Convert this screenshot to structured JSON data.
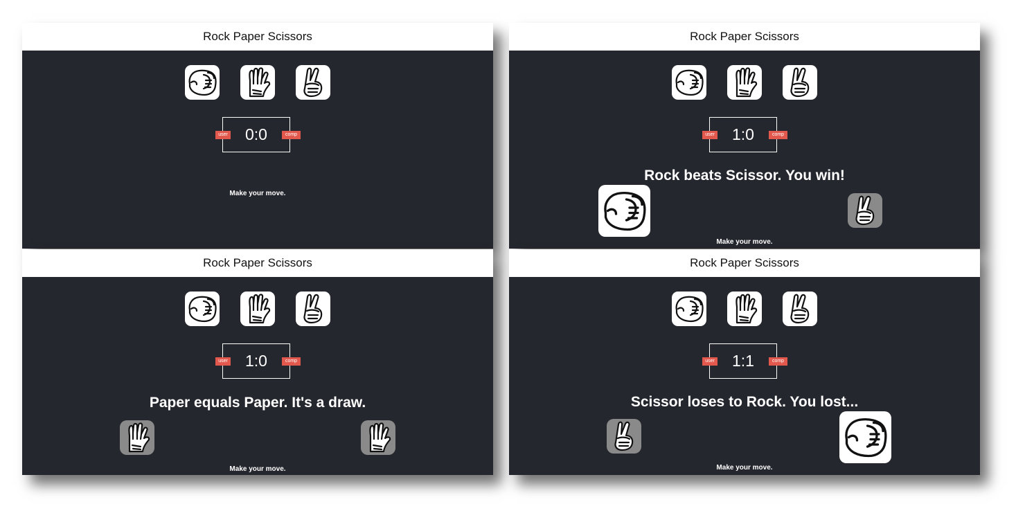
{
  "app_title": "Rock Paper Scissors",
  "labels": {
    "user": "user",
    "comp": "comp",
    "hint": "Make your move."
  },
  "choices": [
    "rock",
    "paper",
    "scissors"
  ],
  "colors": {
    "background": "#25272e",
    "badge": "#e2584d",
    "header": "#ffffff",
    "dim_hand": "#8a8a8a"
  },
  "panels": [
    {
      "title": "Rock Paper Scissors",
      "score": "0:0",
      "result": "",
      "hint": "Make your move."
    },
    {
      "title": "Rock Paper Scissors",
      "score": "1:0",
      "result": "Rock beats Scissor. You win!",
      "hint": "Make your move.",
      "user_hand": "rock-icon",
      "comp_hand": "scissors-icon"
    },
    {
      "title": "Rock Paper Scissors",
      "score": "1:0",
      "result": "Paper equals Paper. It's a draw.",
      "hint": "Make your move.",
      "user_hand": "paper-icon",
      "comp_hand": "paper-icon"
    },
    {
      "title": "Rock Paper Scissors",
      "score": "1:1",
      "result": "Scissor loses to Rock. You lost...",
      "hint": "Make your move.",
      "user_hand": "scissors-icon",
      "comp_hand": "rock-icon"
    }
  ]
}
